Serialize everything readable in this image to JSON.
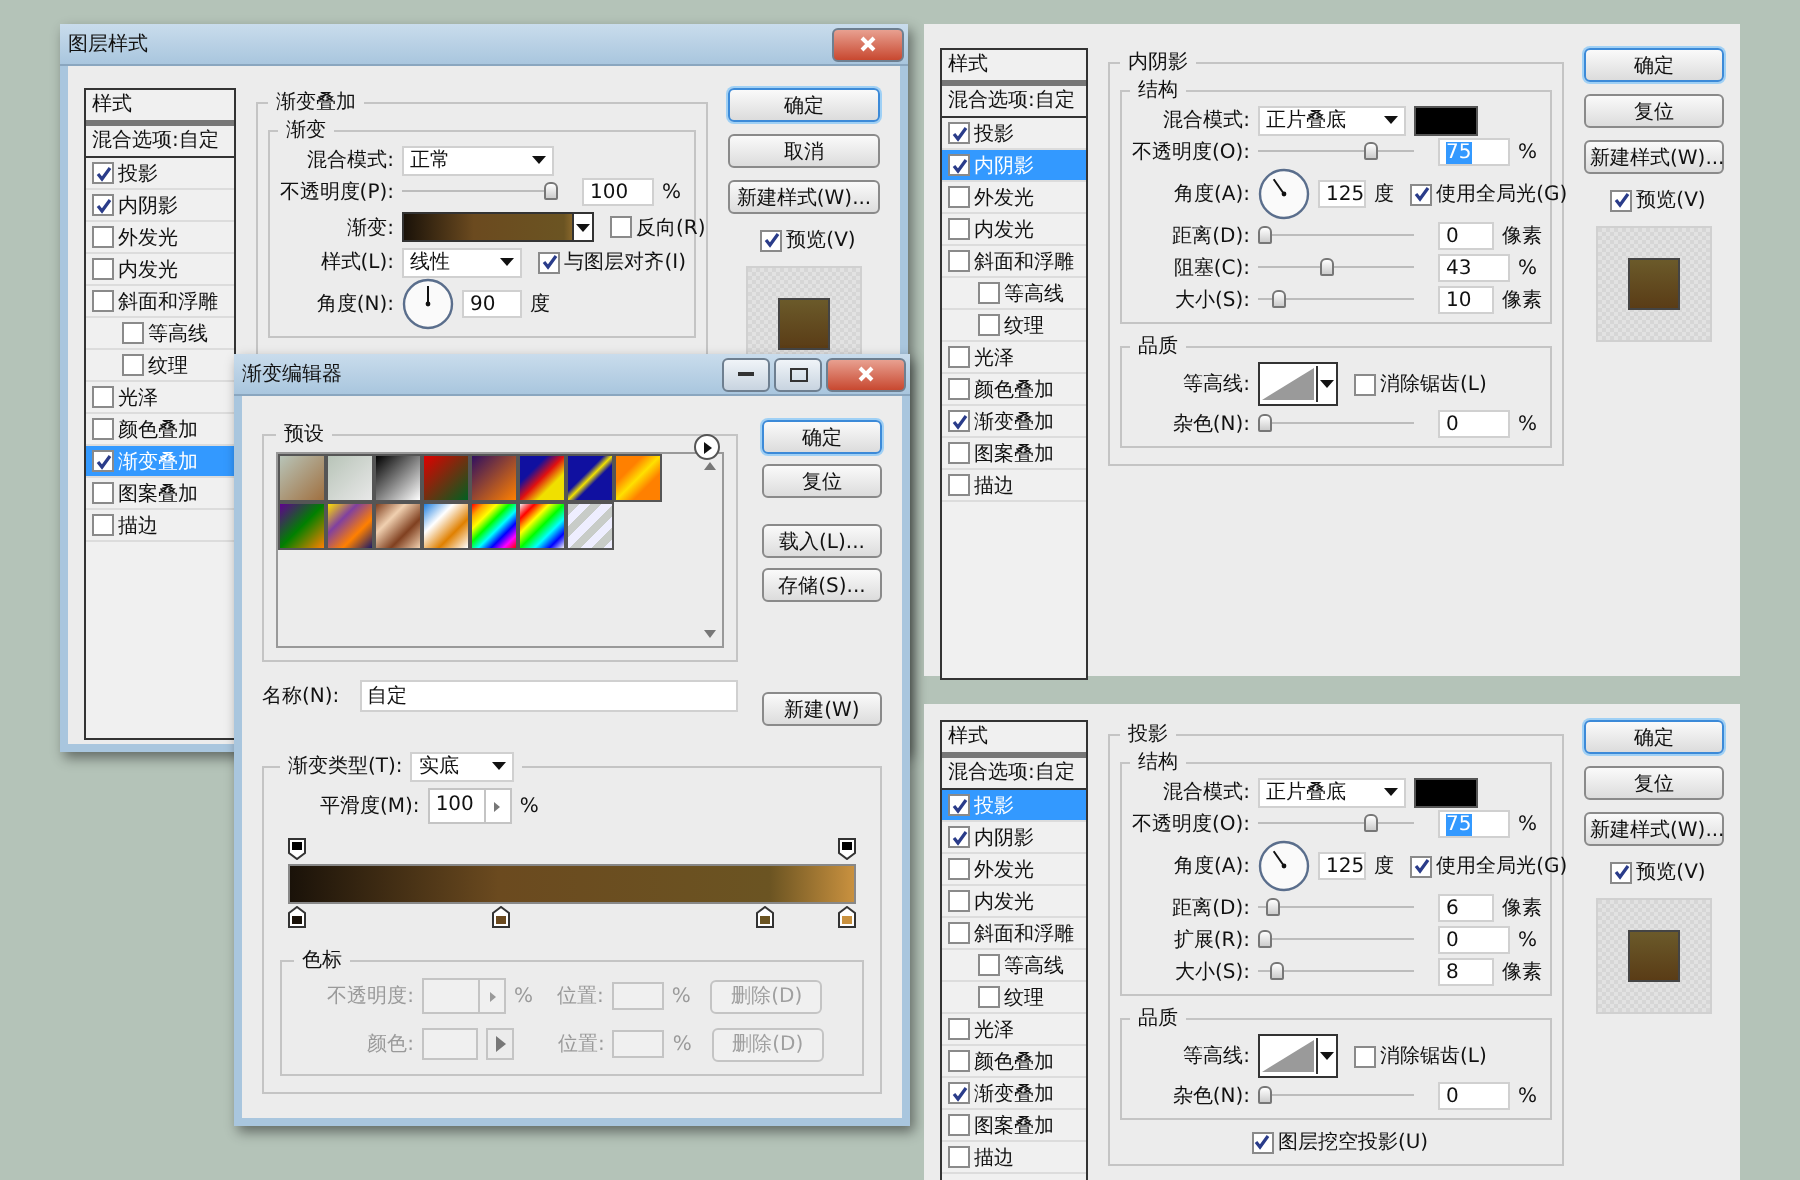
{
  "layer_style_dialog": {
    "title": "图层样式",
    "sidebar": {
      "header": "样式",
      "blend_options": "混合选项:自定",
      "items": [
        {
          "label": "投影",
          "checked": true,
          "selected": false
        },
        {
          "label": "内阴影",
          "checked": true,
          "selected": false
        },
        {
          "label": "外发光",
          "checked": false,
          "selected": false
        },
        {
          "label": "内发光",
          "checked": false,
          "selected": false
        },
        {
          "label": "斜面和浮雕",
          "checked": false,
          "selected": false,
          "children": [
            {
              "label": "等高线",
              "checked": false,
              "selected": false
            },
            {
              "label": "纹理",
              "checked": false,
              "selected": false
            }
          ]
        },
        {
          "label": "光泽",
          "checked": false,
          "selected": false
        },
        {
          "label": "颜色叠加",
          "checked": false,
          "selected": false
        },
        {
          "label": "渐变叠加",
          "checked": true,
          "selected": true
        },
        {
          "label": "图案叠加",
          "checked": false,
          "selected": false
        },
        {
          "label": "描边",
          "checked": false,
          "selected": false
        }
      ]
    },
    "section": {
      "title": "渐变叠加",
      "groups": [
        {
          "title": "渐变",
          "rows": [
            {
              "kind": "select",
              "label": "混合模式:",
              "value": "正常"
            },
            {
              "kind": "slider",
              "label": "不透明度(P):",
              "level": 1,
              "value": "100",
              "unit": "%",
              "highlighted": false
            },
            {
              "kind": "gradient",
              "label": "渐变:",
              "checkbox": {
                "label": "反向(R)",
                "checked": false
              }
            },
            {
              "kind": "select",
              "label": "样式(L):",
              "value": "线性",
              "checkbox": {
                "label": "与图层对齐(I)",
                "checked": true
              }
            },
            {
              "kind": "angle",
              "label": "角度(N):",
              "value": "90",
              "unit": "度"
            }
          ]
        }
      ]
    },
    "buttons": [
      {
        "label": "确定",
        "default": true
      },
      {
        "label": "取消",
        "default": false
      },
      {
        "label": "新建样式(W)...",
        "default": false
      }
    ],
    "preview": {
      "label": "预览(V)",
      "checked": true
    }
  },
  "gradient_editor": {
    "title": "渐变编辑器",
    "presets_title": "预设",
    "buttons": [
      {
        "label": "确定",
        "default": true
      },
      {
        "label": "复位",
        "default": false
      },
      {
        "label": "载入(L)...",
        "default": false
      },
      {
        "label": "存储(S)...",
        "default": false
      }
    ],
    "name_label": "名称(N):",
    "name_value": "自定",
    "new_button": "新建(W)",
    "type_label": "渐变类型(T):",
    "type_value": "实底",
    "smoothness_label": "平滑度(M):",
    "smoothness_value": "100",
    "smoothness_unit": "%",
    "opacity_stops": [
      {
        "level": 0
      },
      {
        "level": 1
      }
    ],
    "color_stops": [
      {
        "level": 0,
        "color": "#1a1209"
      },
      {
        "level": 0.37,
        "color": "#6b4a1f"
      },
      {
        "level": 0.85,
        "color": "#6b5422"
      },
      {
        "level": 1,
        "color": "#c9913f"
      }
    ],
    "stops_title": "色标",
    "stop_rows": [
      {
        "kind": "opacity",
        "label": "不透明度:",
        "unit": "%",
        "position_label": "位置:",
        "position_unit": "%",
        "button": "删除(D)",
        "disabled": true
      },
      {
        "kind": "color",
        "label": "颜色:",
        "position_label": "位置:",
        "position_unit": "%",
        "button": "删除(D)",
        "disabled": true
      }
    ]
  },
  "inner_shadow_panel": {
    "sidebar": {
      "header": "样式",
      "blend_options": "混合选项:自定",
      "items": [
        {
          "label": "投影",
          "checked": true,
          "selected": false
        },
        {
          "label": "内阴影",
          "checked": true,
          "selected": true
        },
        {
          "label": "外发光",
          "checked": false,
          "selected": false
        },
        {
          "label": "内发光",
          "checked": false,
          "selected": false
        },
        {
          "label": "斜面和浮雕",
          "checked": false,
          "selected": false,
          "children": [
            {
              "label": "等高线",
              "checked": false,
              "selected": false
            },
            {
              "label": "纹理",
              "checked": false,
              "selected": false
            }
          ]
        },
        {
          "label": "光泽",
          "checked": false,
          "selected": false
        },
        {
          "label": "颜色叠加",
          "checked": false,
          "selected": false
        },
        {
          "label": "渐变叠加",
          "checked": true,
          "selected": false
        },
        {
          "label": "图案叠加",
          "checked": false,
          "selected": false
        },
        {
          "label": "描边",
          "checked": false,
          "selected": false
        }
      ]
    },
    "section": {
      "title": "内阴影",
      "groups": [
        {
          "title": "结构",
          "rows": [
            {
              "kind": "select",
              "label": "混合模式:",
              "value": "正片叠底",
              "color": "#000000"
            },
            {
              "kind": "slider",
              "label": "不透明度(O):",
              "level": 0.75,
              "value": "75",
              "unit": "%",
              "highlighted": true
            },
            {
              "kind": "angle",
              "label": "角度(A):",
              "value": "125",
              "unit": "度",
              "checkbox": {
                "label": "使用全局光(G)",
                "checked": true
              }
            },
            {
              "kind": "slider",
              "label": "距离(D):",
              "level": 0,
              "value": "0",
              "unit": "像素",
              "highlighted": false
            },
            {
              "kind": "slider",
              "label": "阻塞(C):",
              "level": 0.43,
              "value": "43",
              "unit": "%",
              "highlighted": false
            },
            {
              "kind": "slider",
              "label": "大小(S):",
              "level": 0.1,
              "value": "10",
              "unit": "像素",
              "highlighted": false
            }
          ]
        },
        {
          "title": "品质",
          "rows": [
            {
              "kind": "contour",
              "label": "等高线:",
              "checkbox": {
                "label": "消除锯齿(L)",
                "checked": false
              }
            },
            {
              "kind": "slider",
              "label": "杂色(N):",
              "level": 0,
              "value": "0",
              "unit": "%",
              "highlighted": false
            }
          ]
        }
      ]
    },
    "buttons": [
      {
        "label": "确定",
        "default": true
      },
      {
        "label": "复位",
        "default": false
      },
      {
        "label": "新建样式(W)...",
        "default": false
      }
    ],
    "preview": {
      "label": "预览(V)",
      "checked": true
    }
  },
  "drop_shadow_panel": {
    "sidebar": {
      "header": "样式",
      "blend_options": "混合选项:自定",
      "items": [
        {
          "label": "投影",
          "checked": true,
          "selected": true
        },
        {
          "label": "内阴影",
          "checked": true,
          "selected": false
        },
        {
          "label": "外发光",
          "checked": false,
          "selected": false
        },
        {
          "label": "内发光",
          "checked": false,
          "selected": false
        },
        {
          "label": "斜面和浮雕",
          "checked": false,
          "selected": false,
          "children": [
            {
              "label": "等高线",
              "checked": false,
              "selected": false
            },
            {
              "label": "纹理",
              "checked": false,
              "selected": false
            }
          ]
        },
        {
          "label": "光泽",
          "checked": false,
          "selected": false
        },
        {
          "label": "颜色叠加",
          "checked": false,
          "selected": false
        },
        {
          "label": "渐变叠加",
          "checked": true,
          "selected": false
        },
        {
          "label": "图案叠加",
          "checked": false,
          "selected": false
        },
        {
          "label": "描边",
          "checked": false,
          "selected": false
        }
      ]
    },
    "section": {
      "title": "投影",
      "groups": [
        {
          "title": "结构",
          "rows": [
            {
              "kind": "select",
              "label": "混合模式:",
              "value": "正片叠底",
              "color": "#000000"
            },
            {
              "kind": "slider",
              "label": "不透明度(O):",
              "level": 0.75,
              "value": "75",
              "unit": "%",
              "highlighted": true
            },
            {
              "kind": "angle",
              "label": "角度(A):",
              "value": "125",
              "unit": "度",
              "checkbox": {
                "label": "使用全局光(G)",
                "checked": true
              }
            },
            {
              "kind": "slider",
              "label": "距离(D):",
              "level": 0.06,
              "value": "6",
              "unit": "像素",
              "highlighted": false
            },
            {
              "kind": "slider",
              "label": "扩展(R):",
              "level": 0,
              "value": "0",
              "unit": "%",
              "highlighted": false
            },
            {
              "kind": "slider",
              "label": "大小(S):",
              "level": 0.08,
              "value": "8",
              "unit": "像素",
              "highlighted": false
            }
          ]
        },
        {
          "title": "品质",
          "rows": [
            {
              "kind": "contour",
              "label": "等高线:",
              "checkbox": {
                "label": "消除锯齿(L)",
                "checked": false
              }
            },
            {
              "kind": "slider",
              "label": "杂色(N):",
              "level": 0,
              "value": "0",
              "unit": "%",
              "highlighted": false
            }
          ]
        }
      ],
      "knockout": {
        "label": "图层挖空投影(U)",
        "checked": true
      }
    },
    "buttons": [
      {
        "label": "确定",
        "default": true
      },
      {
        "label": "复位",
        "default": false
      },
      {
        "label": "新建样式(W)...",
        "default": false
      }
    ],
    "preview": {
      "label": "预览(V)",
      "checked": true
    }
  }
}
